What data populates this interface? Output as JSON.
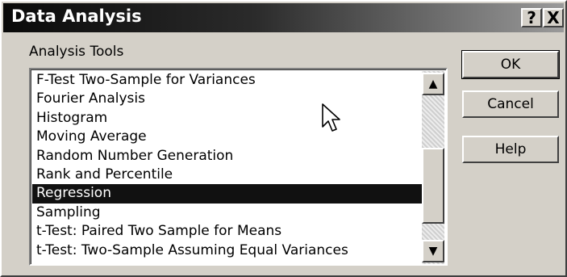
{
  "window": {
    "title": "Data Analysis",
    "help_glyph": "?",
    "close_glyph": "X"
  },
  "analysis_tools_label": "Analysis Tools",
  "list": {
    "items": [
      "F-Test Two-Sample for Variances",
      "Fourier Analysis",
      "Histogram",
      "Moving Average",
      "Random Number Generation",
      "Rank and Percentile",
      "Regression",
      "Sampling",
      "t-Test: Paired Two Sample for Means",
      "t-Test: Two-Sample Assuming Equal Variances"
    ],
    "selected": "Regression"
  },
  "buttons": {
    "ok": "OK",
    "cancel": "Cancel",
    "help": "Help"
  },
  "scrollbar": {
    "up_glyph": "▲",
    "down_glyph": "▼"
  },
  "colors": {
    "dialog_bg": "#d4d0c8",
    "titlebar": "#0a0a0a",
    "selection": "#111111"
  }
}
